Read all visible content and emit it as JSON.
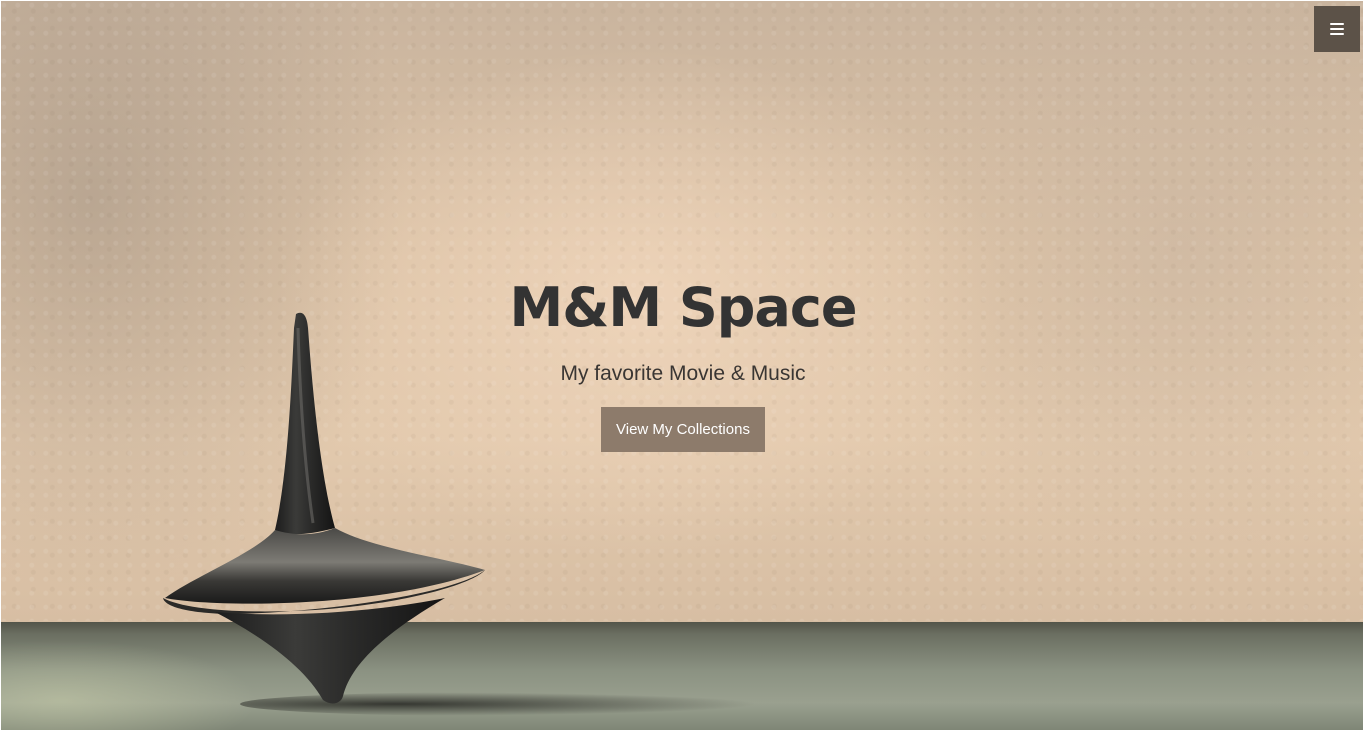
{
  "header": {
    "menu_icon": "hamburger-menu-icon"
  },
  "hero": {
    "title": "M&M Space",
    "subtitle": "My favorite Movie & Music",
    "cta_label": "View My Collections",
    "background_image": "spinning-top-photo"
  },
  "colors": {
    "menu_button_bg": "#5c5248",
    "cta_bg": "#8d7b6b",
    "title_text": "#333333"
  }
}
